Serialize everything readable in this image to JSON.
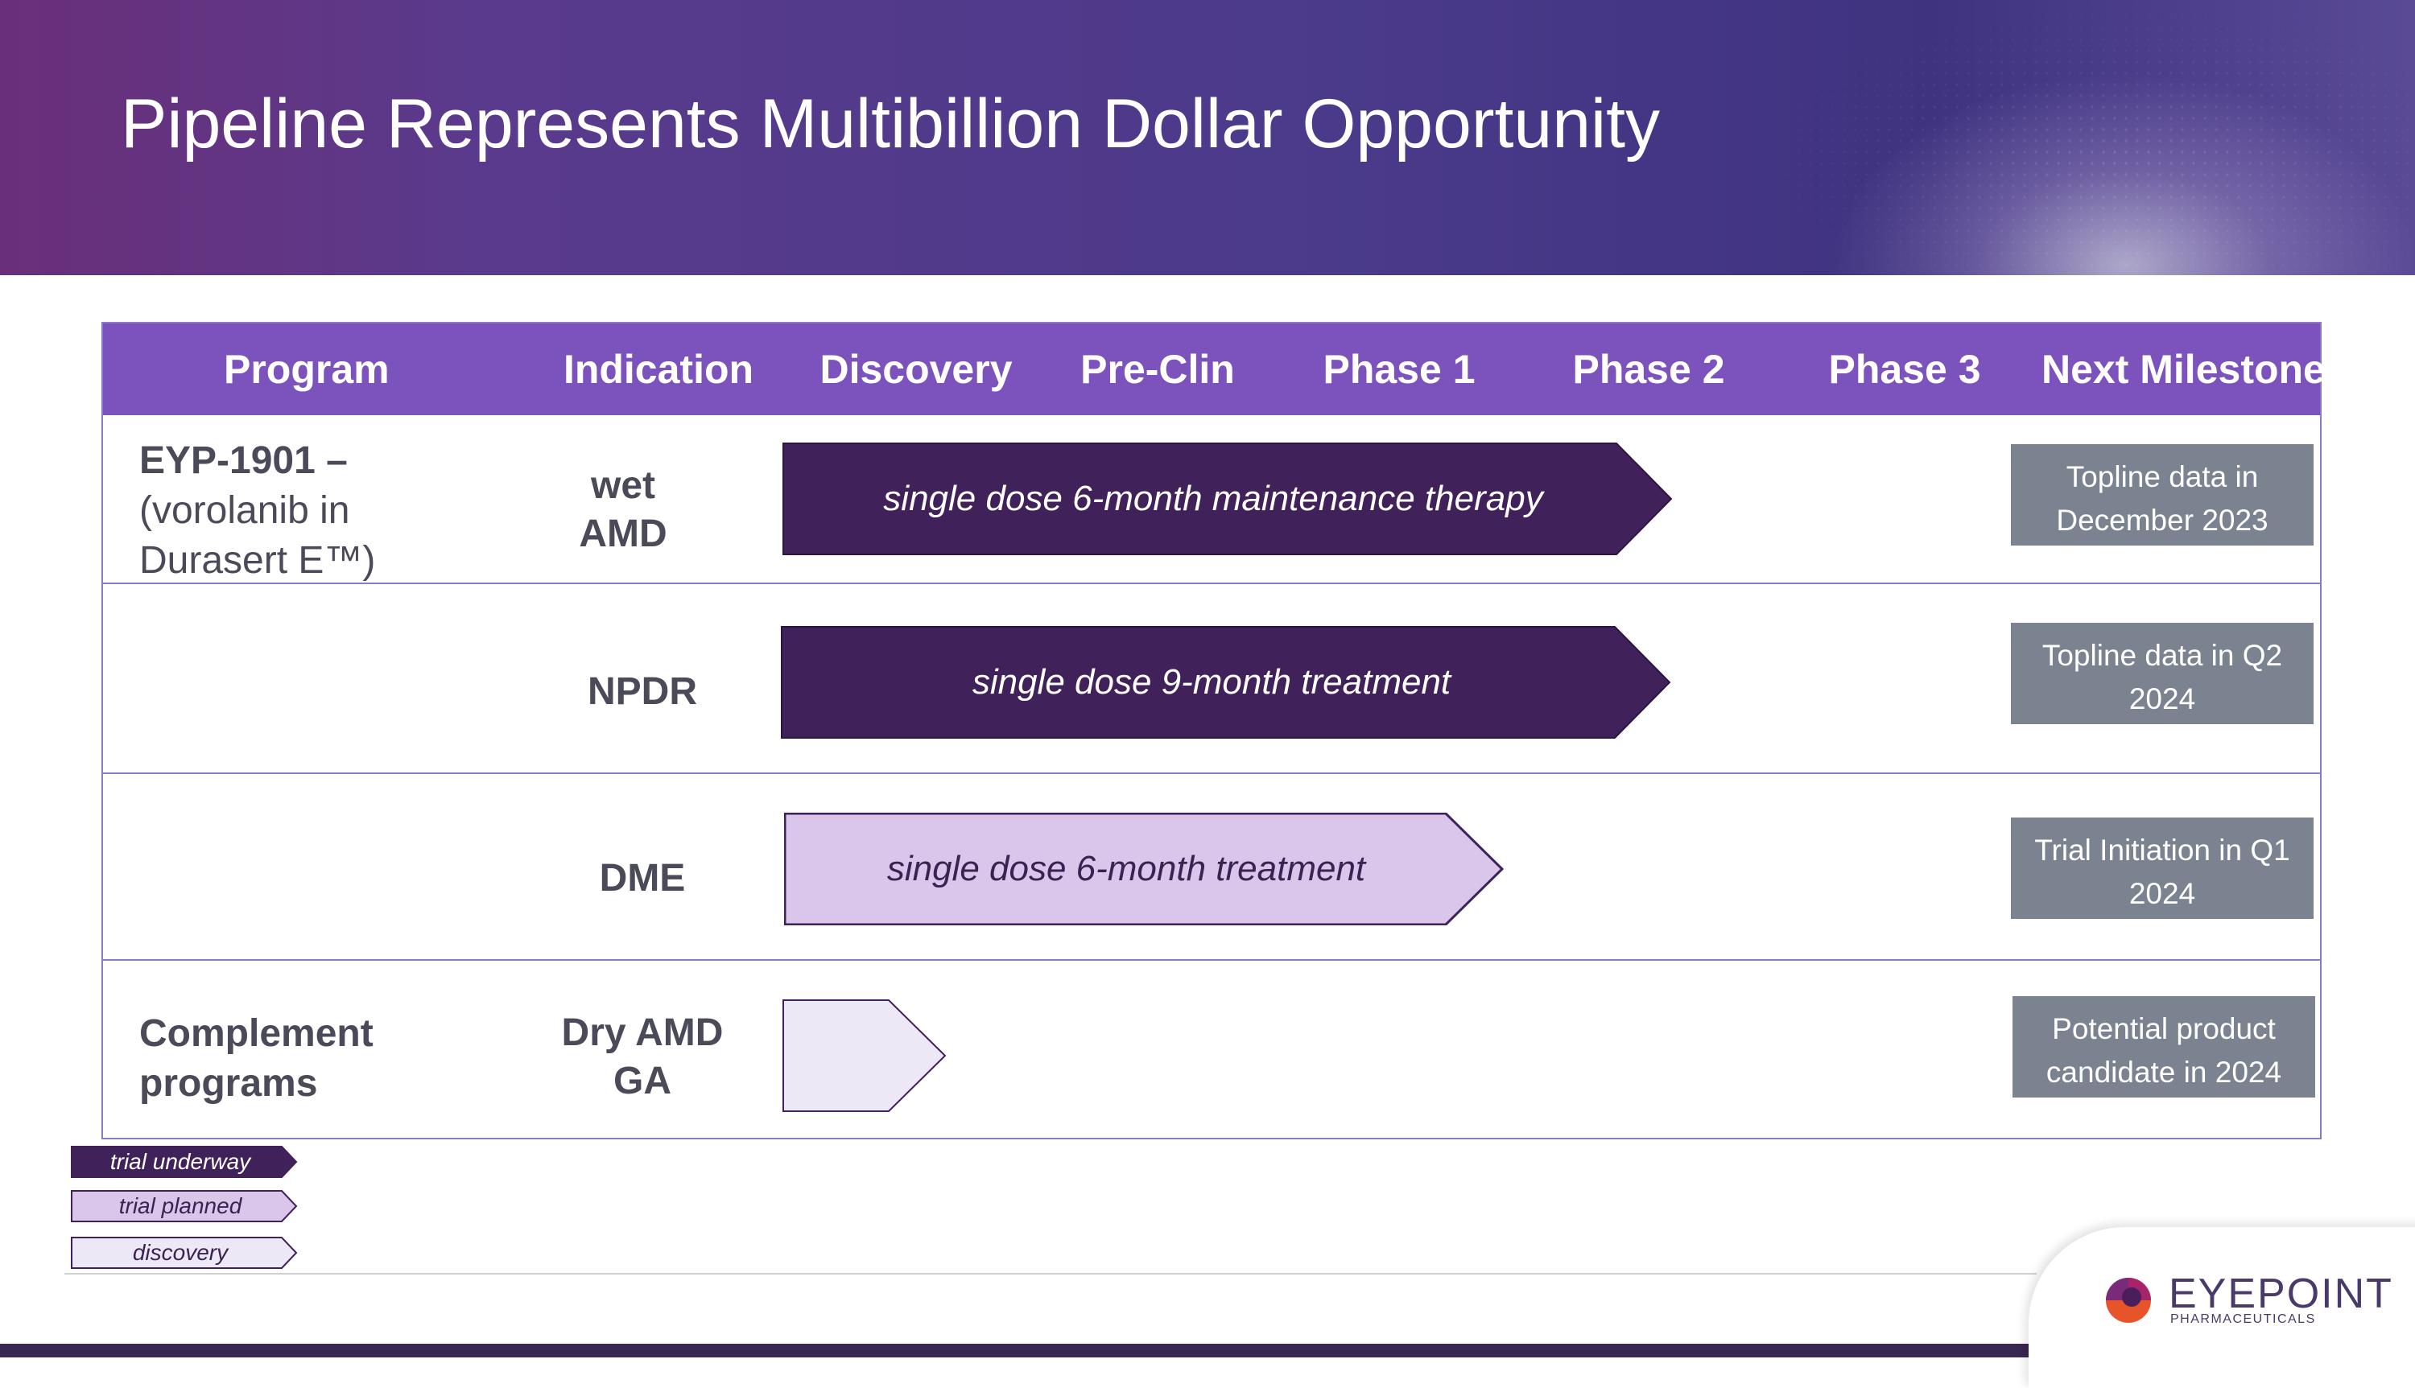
{
  "title": "Pipeline Represents Multibillion Dollar Opportunity",
  "headers": {
    "program": "Program",
    "indication": "Indication",
    "discovery": "Discovery",
    "preclin": "Pre-Clin",
    "phase1": "Phase 1",
    "phase2": "Phase 2",
    "phase3": "Phase 3",
    "milestone": "Next Milestone"
  },
  "rows": [
    {
      "program_bold": "EYP-1901 –",
      "program_rest": [
        "(vorolanib in",
        "Durasert E™)"
      ],
      "indication": [
        "wet",
        "AMD"
      ],
      "bar_label": "single dose 6-month maintenance therapy",
      "status": "trial underway",
      "milestone": [
        "Topline data in",
        "December 2023"
      ]
    },
    {
      "indication": [
        "NPDR"
      ],
      "bar_label": "single dose 9-month treatment",
      "status": "trial underway",
      "milestone": [
        "Topline data in Q2",
        "2024"
      ]
    },
    {
      "indication": [
        "DME"
      ],
      "bar_label": "single dose 6-month treatment",
      "status": "trial planned",
      "milestone": [
        "Trial Initiation in Q1",
        "2024"
      ]
    },
    {
      "program_bold": "Complement",
      "program_bold_2": "programs",
      "indication": [
        "Dry AMD",
        "GA"
      ],
      "bar_label": "",
      "status": "discovery",
      "milestone": [
        "Potential  product",
        "candidate in 2024"
      ]
    }
  ],
  "legend": [
    "trial underway",
    "trial planned",
    "discovery"
  ],
  "colors": {
    "header_bg": "#7c53bd",
    "trial_underway": "#41215a",
    "trial_planned": "#d9c6ea",
    "discovery": "#ede8f5",
    "milestone_bg": "#7b8290"
  },
  "logo": {
    "word": "EYEPOINT",
    "sub": "PHARMACEUTICALS"
  }
}
